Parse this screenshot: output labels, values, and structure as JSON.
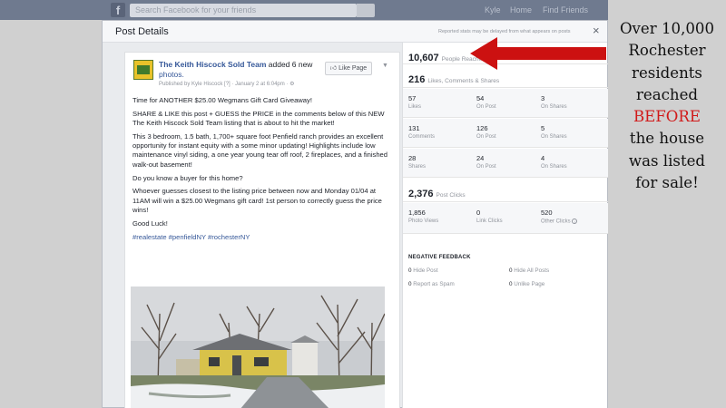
{
  "background": {
    "logo": "f",
    "search_placeholder": "Search Facebook for your friends",
    "nav": [
      "Kyle",
      "Home",
      "Find Friends"
    ]
  },
  "modal": {
    "title": "Post Details",
    "note": "Reported stats may be delayed from what appears on posts",
    "close": "×"
  },
  "post": {
    "author": "The Keith Hiscock Sold Team",
    "action": " added 6 new",
    "action_link": "photos.",
    "meta": "Published by Kyle Hiscock [?] · January 2 at 6:04pm · ⚙",
    "like_button": "Like Page",
    "paragraphs": [
      "Time for ANOTHER $25.00 Wegmans Gift Card Giveaway!",
      "SHARE & LIKE this post + GUESS the PRICE in the comments below of this NEW The Keith Hiscock Sold Team listing that is about to hit the market!",
      "This 3 bedroom, 1.5 bath, 1,700+ square foot Penfield ranch provides an excellent opportunity for instant equity with a some minor updating! Highlights include low maintenance vinyl siding, a one year young tear off roof, 2 fireplaces, and a finished walk-out basement!",
      "Do you know a buyer for this home?",
      "Whoever guesses closest to the listing price between now and Monday 01/04 at 11AM will win a $25.00 Wegmans gift card! 1st person to correctly guess the price wins!",
      "Good Luck!"
    ],
    "hashtags": "#realestate #penfieldNY #rochesterNY"
  },
  "insights": {
    "reach": {
      "value": "10,607",
      "label": "People Reached"
    },
    "engagement": {
      "value": "216",
      "label": "Likes, Comments & Shares"
    },
    "grid": [
      [
        {
          "num": "57",
          "label": "Likes"
        },
        {
          "num": "54",
          "label": "On Post"
        },
        {
          "num": "3",
          "label": "On Shares"
        }
      ],
      [
        {
          "num": "131",
          "label": "Comments"
        },
        {
          "num": "126",
          "label": "On Post"
        },
        {
          "num": "5",
          "label": "On Shares"
        }
      ],
      [
        {
          "num": "28",
          "label": "Shares"
        },
        {
          "num": "24",
          "label": "On Post"
        },
        {
          "num": "4",
          "label": "On Shares"
        }
      ]
    ],
    "clicks": {
      "value": "2,376",
      "label": "Post Clicks"
    },
    "click_grid": [
      {
        "num": "1,856",
        "label": "Photo Views"
      },
      {
        "num": "0",
        "label": "Link Clicks"
      },
      {
        "num": "520",
        "label": "Other Clicks"
      }
    ],
    "negative_title": "NEGATIVE FEEDBACK",
    "negative": [
      {
        "num": "0",
        "label": "Hide Post"
      },
      {
        "num": "0",
        "label": "Hide All Posts"
      },
      {
        "num": "0",
        "label": "Report as Spam"
      },
      {
        "num": "0",
        "label": "Unlike Page"
      }
    ]
  },
  "annotation": {
    "lines_before": [
      "Over 10,000",
      "Rochester",
      "residents",
      "reached"
    ],
    "highlight": "BEFORE",
    "lines_after": [
      "the house",
      "was listed",
      "for sale!"
    ],
    "highlight_color": "#d11a1a",
    "arrow_color": "#cc1111"
  }
}
